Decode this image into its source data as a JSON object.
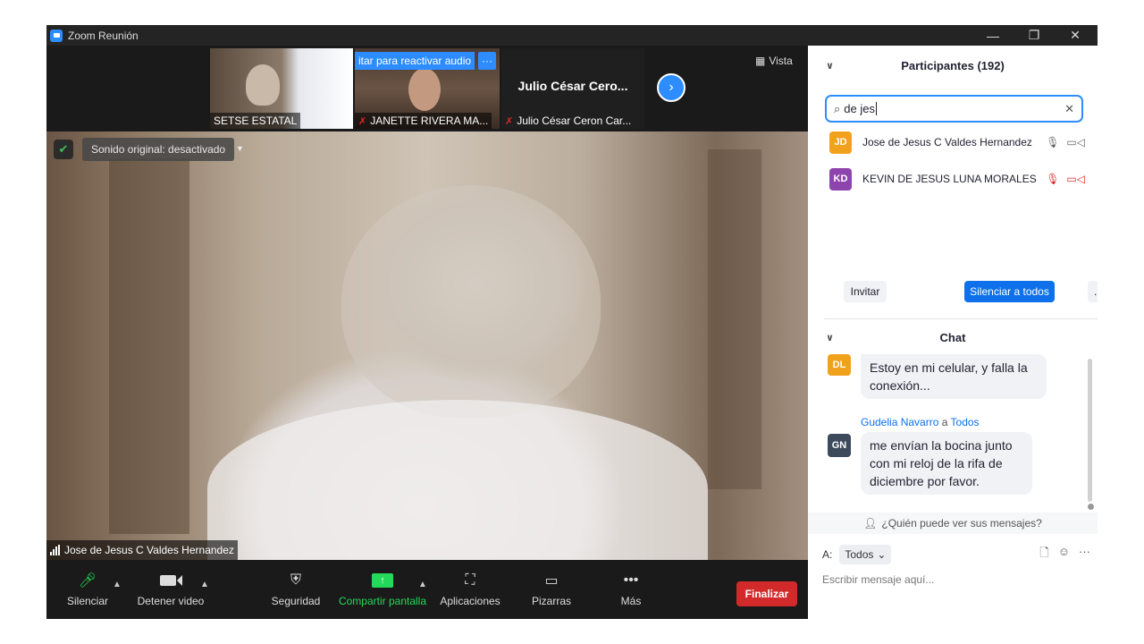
{
  "window": {
    "title": "Zoom Reunión",
    "minimize": "—",
    "restore": "❐",
    "close": "✕"
  },
  "video_strip": {
    "thumbs": [
      {
        "label": "SETSE ESTATAL"
      },
      {
        "label": "JANETTE RIVERA MA...",
        "banner": "itar para reactivar audio",
        "more": "···"
      },
      {
        "name": "Julio César Cero...",
        "label": "Julio César Ceron Car..."
      }
    ],
    "next": "›",
    "view_label": "Vista"
  },
  "main_video": {
    "sound_label": "Sonido original: desactivado",
    "speaker": "Jose de Jesus C Valdes Hernandez"
  },
  "toolbar": {
    "mute": "Silenciar",
    "stop_video": "Detener video",
    "security": "Seguridad",
    "share": "Compartir pantalla",
    "apps": "Aplicaciones",
    "whiteboards": "Pizarras",
    "more": "Más",
    "end": "Finalizar"
  },
  "participants": {
    "title": "Participantes (192)",
    "search_value": "de jes",
    "list": [
      {
        "initials": "JD",
        "name": "Jose de Jesus C Valdes Hernandez",
        "color": "#f0a21c"
      },
      {
        "initials": "KD",
        "name": "KEVIN DE JESUS LUNA MORALES",
        "color": "#8e44ad"
      }
    ],
    "invite": "Invitar",
    "mute_all": "Silenciar a todos",
    "more": "..."
  },
  "chat": {
    "title": "Chat",
    "messages": [
      {
        "initials": "DL",
        "color": "#f0a21c",
        "text": "Estoy en mi celular, y falla la conexión..."
      },
      {
        "sender": "Gudelia Navarro",
        "to_word": "a",
        "to": "Todos",
        "initials": "GN",
        "color": "#3d4a5c",
        "text": "me envían la bocina junto con mi reloj de la rifa de diciembre por favor."
      }
    ],
    "who_can_see": "¿Quién puede ver sus mensajes?",
    "to_label": "A:",
    "to_value": "Todos",
    "placeholder": "Escribir mensaje aquí..."
  }
}
